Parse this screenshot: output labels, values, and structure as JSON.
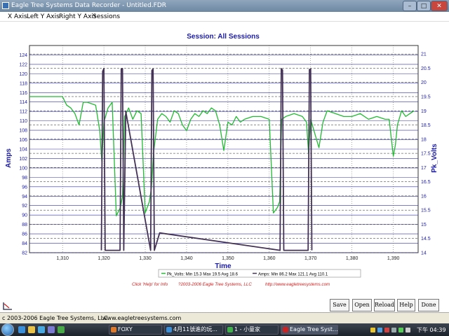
{
  "window": {
    "title": "Eagle Tree Systems Data Recorder - Untitled.FDR",
    "min_glyph": "–",
    "max_glyph": "□",
    "close_glyph": "✕"
  },
  "menu": {
    "items": [
      "X Axis",
      "Left Y Axis",
      "Right Y Axis",
      "Sessions"
    ]
  },
  "chart": {
    "title": "Session: All Sessions",
    "xlabel": "Time",
    "ylabel_left": "Amps",
    "ylabel_right": "Pk_Volts",
    "legend_volts": "Pk_Volts:  Min 15.3 Max 19.5 Avg 18.6",
    "legend_amps": "Amps:  Min 86.2 Max 121.1 Avg 110.1",
    "footer_help": "Click 'Help' for Info",
    "footer_copyright": "?2003-2006 Eagle Tree Systems, LLC",
    "footer_url": "http://www.eagletreesystems.com",
    "colors": {
      "volts": "#22bb33",
      "amps": "#443355",
      "axis_text": "#1a1aa8",
      "grid_major": "#3030a0",
      "footer": "#cc2222"
    }
  },
  "chart_data": {
    "type": "line",
    "title": "Session: All Sessions",
    "xlabel": "Time",
    "ylabel": "Amps",
    "ylabel_right": "Pk_Volts",
    "xlim": [
      1302,
      1396
    ],
    "ylim": [
      82,
      126
    ],
    "ylim_right": [
      14,
      21.3
    ],
    "xticks": [
      1310,
      1320,
      1330,
      1340,
      1350,
      1360,
      1370,
      1380,
      1390
    ],
    "xtick_labels": [
      "1,310",
      "1,320",
      "1,330",
      "1,340",
      "1,350",
      "1,360",
      "1,370",
      "1,380",
      "1,390"
    ],
    "yticks_left": [
      82,
      84,
      86,
      88,
      90,
      92,
      94,
      96,
      98,
      100,
      102,
      104,
      106,
      108,
      110,
      112,
      114,
      116,
      118,
      120,
      122,
      124
    ],
    "yticks_right": [
      14,
      14.5,
      15,
      15.5,
      16,
      16.5,
      17,
      17.5,
      18,
      18.5,
      19,
      19.5,
      20,
      20.5,
      21
    ],
    "legend": "bottom",
    "grid": true,
    "series": [
      {
        "name": "Pk_Volts",
        "axis": "right",
        "x": [
          1302,
          1310,
          1311,
          1312,
          1313,
          1314,
          1315,
          1316,
          1318,
          1319,
          1319.5,
          1320,
          1321,
          1322,
          1323,
          1324,
          1324.5,
          1325,
          1326,
          1327,
          1328,
          1329,
          1330,
          1331,
          1331.5,
          1332,
          1333,
          1334,
          1335,
          1336,
          1337,
          1338,
          1339,
          1340,
          1341,
          1342,
          1343,
          1344,
          1345,
          1346,
          1347,
          1348,
          1349,
          1350,
          1351,
          1352,
          1353,
          1354,
          1356,
          1358,
          1360,
          1361,
          1362,
          1362.5,
          1363,
          1364,
          1366,
          1368,
          1369,
          1369.5,
          1370,
          1371,
          1372,
          1373,
          1374,
          1376,
          1378,
          1380,
          1382,
          1384,
          1386,
          1388,
          1389,
          1390,
          1390.5,
          1391,
          1392,
          1393,
          1394,
          1395
        ],
        "values": [
          19.5,
          19.5,
          19.2,
          19.1,
          18.9,
          18.5,
          19.3,
          19.3,
          19.2,
          18.3,
          17.2,
          18.6,
          19.1,
          19.3,
          15.3,
          15.6,
          16.0,
          18.8,
          19.1,
          18.7,
          19.0,
          18.9,
          15.4,
          15.8,
          16.3,
          17.5,
          18.7,
          18.9,
          18.8,
          18.6,
          19.0,
          18.9,
          18.5,
          18.3,
          18.7,
          18.9,
          18.8,
          19.0,
          18.9,
          19.1,
          19.0,
          18.5,
          17.6,
          18.6,
          18.5,
          18.8,
          18.6,
          18.7,
          18.8,
          18.8,
          18.7,
          15.4,
          15.6,
          15.8,
          18.7,
          18.8,
          18.9,
          18.8,
          18.6,
          17.5,
          18.7,
          18.2,
          17.7,
          18.6,
          19.0,
          18.9,
          18.8,
          18.8,
          18.9,
          18.7,
          18.8,
          18.7,
          18.7,
          17.4,
          17.8,
          18.5,
          19.0,
          18.8,
          18.9,
          19.0
        ]
      },
      {
        "name": "Amps",
        "axis": "left",
        "x": [
          1319.4,
          1319.7,
          1320.0,
          1320.3,
          1323.9,
          1324.2,
          1324.5,
          1324.8,
          1325.3,
          1331.3,
          1331.6,
          1331.9,
          1332.2,
          1333.5,
          1362.6,
          1362.9,
          1363.2,
          1363.5,
          1369.4,
          1369.7,
          1370.0,
          1370.3
        ],
        "values": [
          82.5,
          120.5,
          121.1,
          82.5,
          82.5,
          121.0,
          121.1,
          82.5,
          112.0,
          82.5,
          120.7,
          121.0,
          82.5,
          86.2,
          82.5,
          121.1,
          120.8,
          82.5,
          82.5,
          120.9,
          121.0,
          82.5
        ]
      }
    ]
  },
  "buttons": {
    "save": "Save",
    "open": "Open",
    "reload": "Reload",
    "help": "Help",
    "done": "Done"
  },
  "status": {
    "copyright": "c 2003-2006 Eagle Tree Systems, LLC",
    "url": "www.eagletreesystems.com"
  },
  "taskbar": {
    "tasks": [
      "FOXY",
      "4月11號進的玩...",
      "1 - 小童家",
      "Eagle Tree Syst..."
    ],
    "clock": "下午 04:39"
  }
}
